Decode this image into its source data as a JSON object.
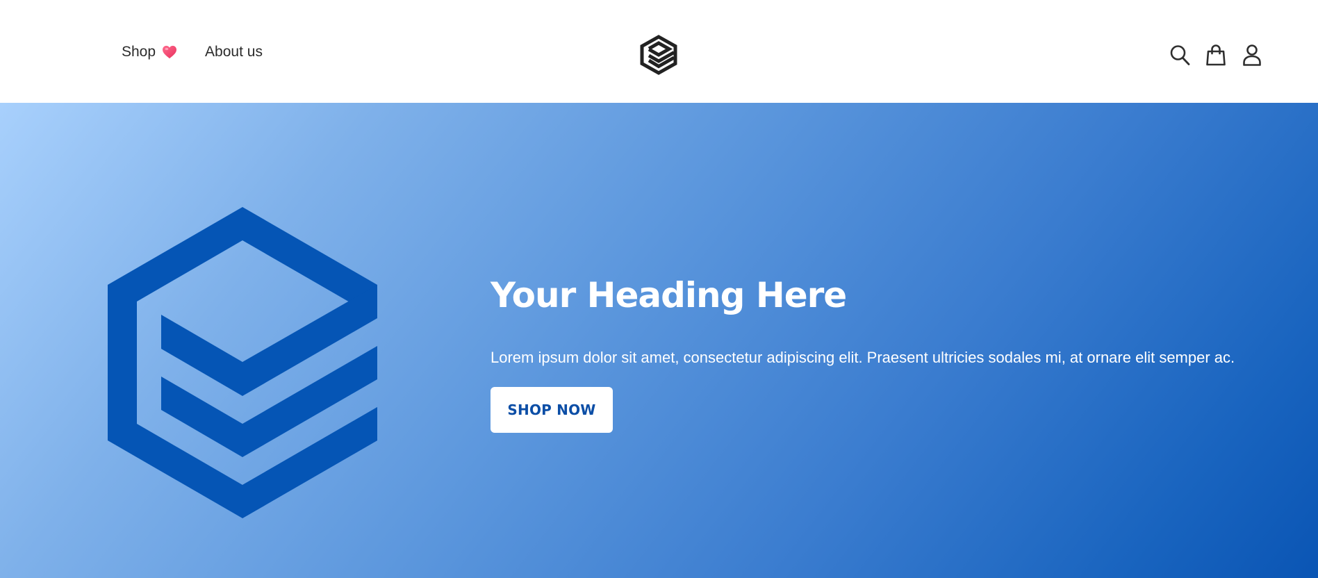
{
  "header": {
    "nav": [
      {
        "label": "Shop",
        "icon": "heart-icon"
      },
      {
        "label": "About us"
      }
    ],
    "logo_icon": "cube-layers-logo",
    "actions": [
      {
        "icon": "search-icon"
      },
      {
        "icon": "shopping-bag-icon"
      },
      {
        "icon": "user-icon"
      }
    ]
  },
  "hero": {
    "heading": "Your Heading Here",
    "text": "Lorem ipsum dolor sit amet, consectetur adipiscing elit. Praesent ultricies sodales mi, at ornare elit semper ac.",
    "button_label": "SHOP NOW",
    "graphic_icon": "cube-layers-graphic"
  },
  "colors": {
    "accent": "#0a55b4",
    "heart": "#f0466e",
    "text_dark": "#2b2b2b",
    "gradient_start": "#a8d0fc",
    "gradient_end": "#0a55b4"
  }
}
